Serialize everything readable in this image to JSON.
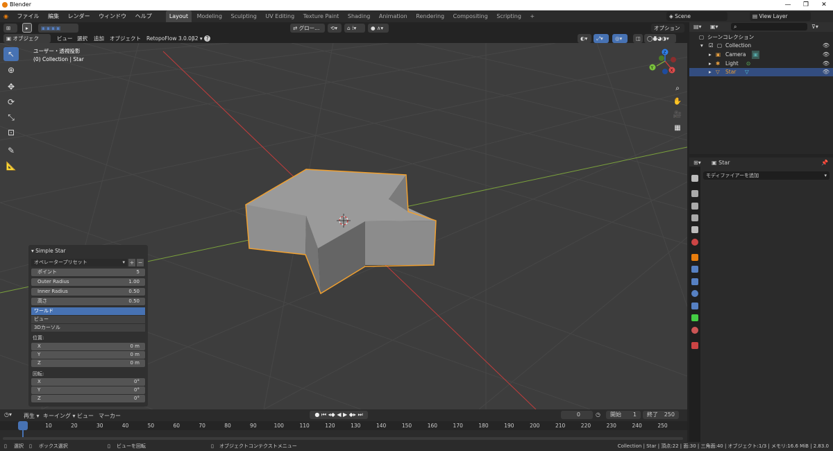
{
  "window": {
    "title": "Blender",
    "minimize": "—",
    "maximize": "❐",
    "close": "✕"
  },
  "menu": {
    "items": [
      "ファイル",
      "編集",
      "レンダー",
      "ウィンドウ",
      "ヘルプ"
    ]
  },
  "workspaces": [
    "Layout",
    "Modeling",
    "Sculpting",
    "UV Editing",
    "Texture Paint",
    "Shading",
    "Animation",
    "Rendering",
    "Compositing",
    "Scripting"
  ],
  "active_workspace": "Layout",
  "scene": {
    "label": "Scene",
    "view_layer": "View Layer"
  },
  "viewport_header": {
    "mode": "オブジェクト...",
    "menus": [
      "ビュー",
      "選択",
      "追加",
      "オブジェクト"
    ],
    "addon": "RetopoFlow 3.0.0β2",
    "transform_orientation": "グロー...",
    "options": "オプション"
  },
  "viewport": {
    "view_title": "ユーザー・透視投影",
    "view_subtitle": "(0) Collection | Star",
    "gizmo_axes": [
      "X",
      "Y",
      "Z"
    ]
  },
  "operator_panel": {
    "title": "Simple Star",
    "preset": "オペレータープリセット",
    "fields": [
      {
        "label": "ポイント",
        "value": "5"
      },
      {
        "label": "Outer Radius",
        "value": "1.00"
      },
      {
        "label": "Inner Radius",
        "value": "0.50"
      },
      {
        "label": "高さ",
        "value": "0.50"
      }
    ],
    "align_options": [
      "ワールド",
      "ビュー",
      "3Dカーソル"
    ],
    "align_selected": "ワールド",
    "location_label": "位置:",
    "location": [
      {
        "axis": "X",
        "value": "0 m"
      },
      {
        "axis": "Y",
        "value": "0 m"
      },
      {
        "axis": "Z",
        "value": "0 m"
      }
    ],
    "rotation_label": "回転:",
    "rotation": [
      {
        "axis": "X",
        "value": "0°"
      },
      {
        "axis": "Y",
        "value": "0°"
      },
      {
        "axis": "Z",
        "value": "0°"
      }
    ]
  },
  "outliner": {
    "root": "シーンコレクション",
    "collection": "Collection",
    "items": [
      "Camera",
      "Light",
      "Star"
    ],
    "selected": "Star"
  },
  "properties": {
    "object_name": "Star",
    "add_modifier": "モディファイアーを追加"
  },
  "timeline": {
    "menus": [
      "再生",
      "キーイング",
      "ビュー",
      "マーカー"
    ],
    "current_frame": "0",
    "start_label": "開始",
    "start": "1",
    "end_label": "終了",
    "end": "250",
    "ticks": [
      "0",
      "10",
      "20",
      "30",
      "40",
      "50",
      "60",
      "70",
      "80",
      "90",
      "100",
      "110",
      "120",
      "130",
      "140",
      "150",
      "160",
      "170",
      "180",
      "190",
      "200",
      "210",
      "220",
      "230",
      "240",
      "250"
    ]
  },
  "statusbar": {
    "select": "選択",
    "box_select": "ボックス選択",
    "rotate_view": "ビューを回転",
    "context_menu": "オブジェクトコンテクストメニュー",
    "stats": "Collection | Star | 頂点:22 | 面:30 | 三角面:40 | オブジェクト:1/3 | メモリ:16.6 MiB | 2.83.0"
  },
  "colors": {
    "accent": "#4772b3",
    "selection_outline": "#f0a030",
    "x_axis": "#c43c3c",
    "y_axis": "#7ba23c"
  }
}
